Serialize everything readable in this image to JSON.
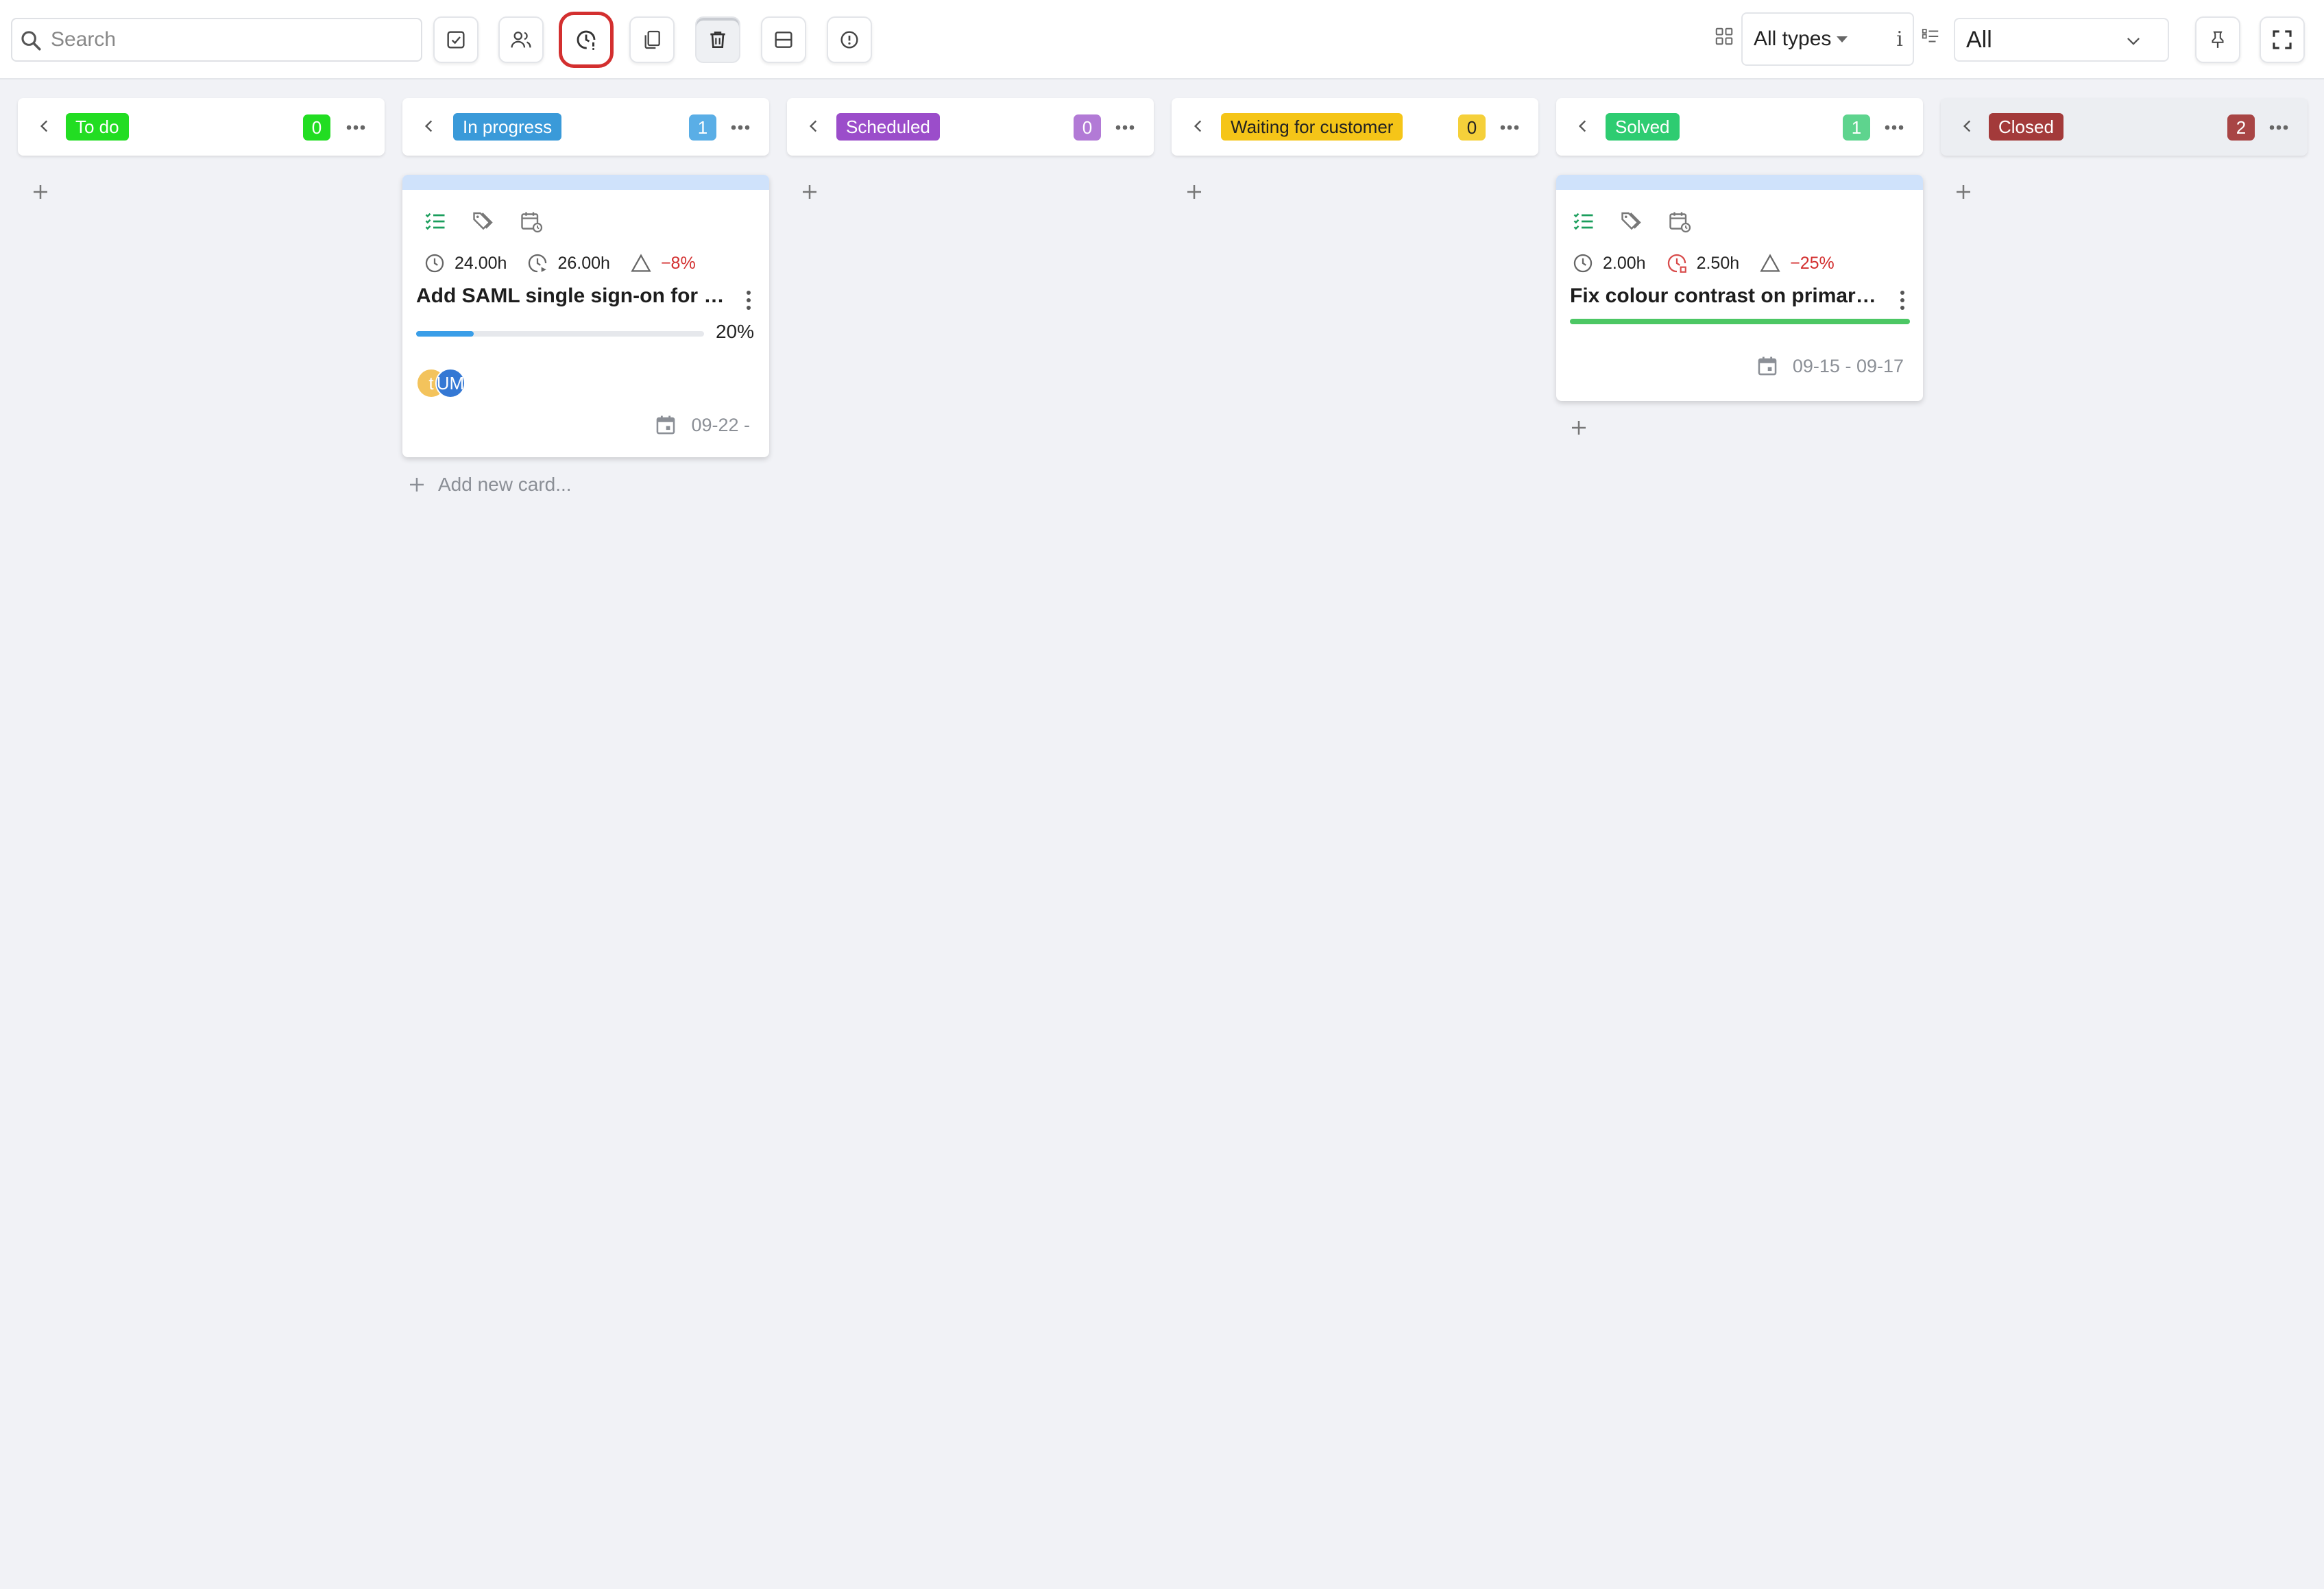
{
  "toolbar": {
    "search_placeholder": "Search",
    "type_select": "All types",
    "type_info": "i",
    "filter_select": "All"
  },
  "columns": [
    {
      "label": "To do",
      "count": "0",
      "label_color": "#22dd22",
      "badge_color": "#22dd22"
    },
    {
      "label": "In progress",
      "count": "1",
      "label_color": "#3a9ad9",
      "badge_color": "#5aaee6"
    },
    {
      "label": "Scheduled",
      "count": "0",
      "label_color": "#9b4dca",
      "badge_color": "#b27ad6"
    },
    {
      "label": "Waiting for customer",
      "count": "0",
      "label_color": "#f5c518",
      "badge_color": "#f5d03a"
    },
    {
      "label": "Solved",
      "count": "1",
      "label_color": "#2ecc71",
      "badge_color": "#5ed48e"
    },
    {
      "label": "Closed",
      "count": "2",
      "label_color": "#a33a3a",
      "badge_color": "#a84545"
    }
  ],
  "cards": {
    "inprogress": {
      "estimate": "24.00h",
      "logged": "26.00h",
      "variance": "−8%",
      "title": "Add SAML single sign-on for staf...",
      "progress": 20,
      "progress_label": "20%",
      "avatars": [
        {
          "initials": "t",
          "color": "#f3c35c"
        },
        {
          "initials": "UM",
          "color": "#3478d4"
        }
      ],
      "date": "09-22 -"
    },
    "solved": {
      "estimate": "2.00h",
      "logged": "2.50h",
      "variance": "−25%",
      "title": "Fix colour contrast on primary b...",
      "date": "09-15 - 09-17"
    }
  },
  "add_new_card": "Add new card...",
  "icons": [
    "search-icon",
    "checkbox-icon",
    "users-icon",
    "clock-alert-icon",
    "copy-icon",
    "trash-icon",
    "layout-icon",
    "info-circle-icon",
    "grid-icon",
    "list-icon",
    "chevron-down-icon",
    "pin-icon",
    "fullscreen-icon",
    "chevron-left-icon",
    "more-icon",
    "plus-icon",
    "checklist-icon",
    "tags-icon",
    "calendar-clock-icon",
    "clock-icon",
    "triangle-icon",
    "calendar-icon",
    "kebab-icon"
  ],
  "colors": {
    "highlight_ring": "#d32f2f",
    "progress_fill": "#3a9ee8",
    "solved_bar": "#4cc764",
    "negative": "#d32f2f",
    "card_topbar": "#cfe2fb"
  }
}
